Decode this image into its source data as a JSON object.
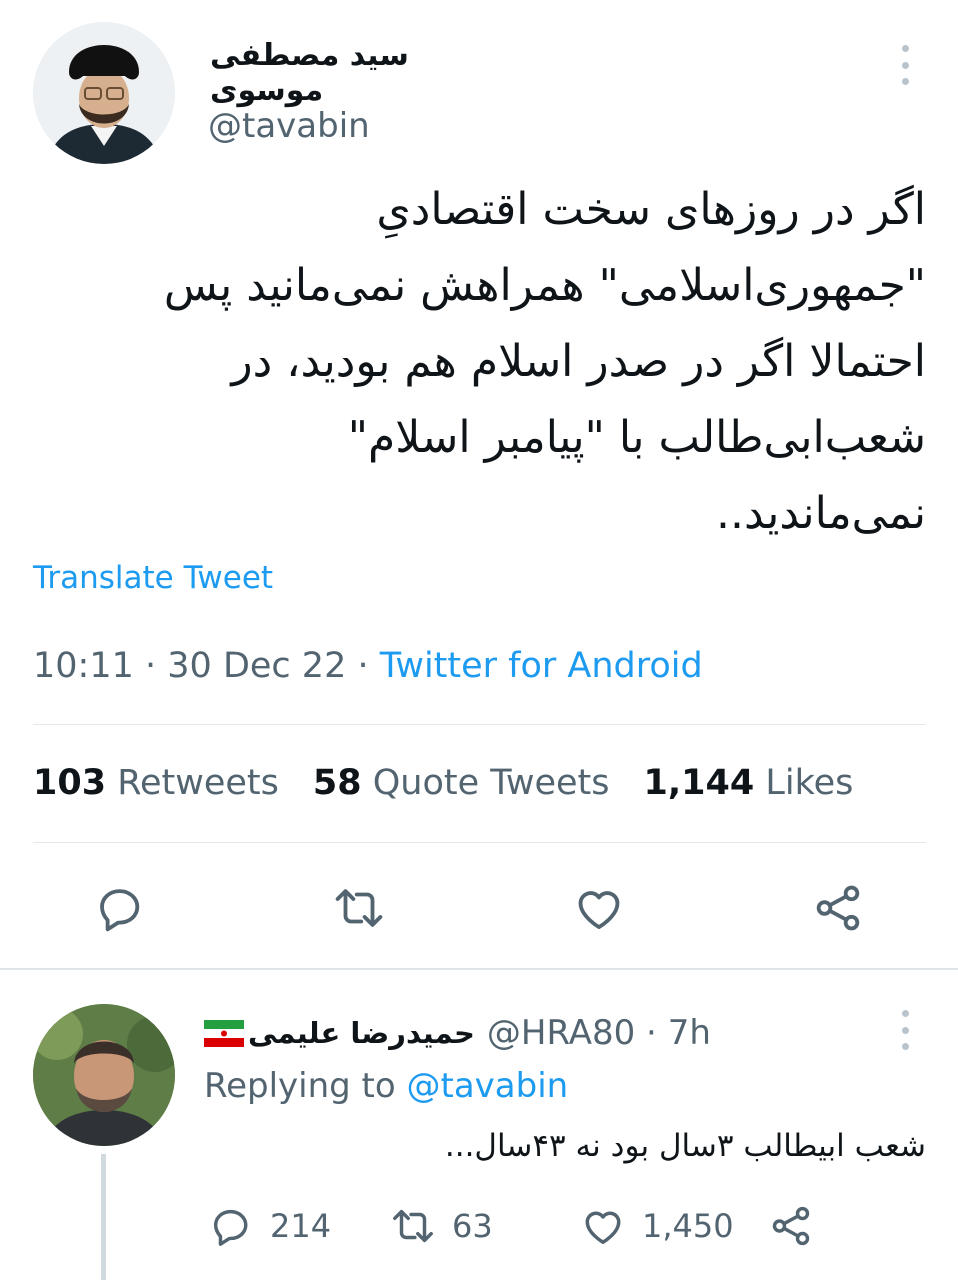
{
  "tweet": {
    "author_name": "سید مصطفی موسوی",
    "author_handle": "@tavabin",
    "body_lines": [
      "اگر در روزهای سخت اقتصادیِ",
      "\"جمهوری‌اسلامی\" همراهش نمی‌مانید پس",
      "احتمالا اگر در صدر اسلام هم بودید، در",
      "شعب‌ابی‌طالب با \"پیامبر اسلام\"",
      "نمی‌ماندید.."
    ],
    "translate_label": "Translate Tweet",
    "time": "10:11",
    "date": "30 Dec 22",
    "source": "Twitter for Android",
    "stats": {
      "retweets_count": "103",
      "retweets_label": "Retweets",
      "quotes_count": "58",
      "quotes_label": "Quote Tweets",
      "likes_count": "1,144",
      "likes_label": "Likes"
    }
  },
  "reply": {
    "author_name": "حمیدرضا علیمی",
    "author_handle": "@HRA80",
    "age": "7h",
    "replying_prefix": "Replying to",
    "replying_to": "@tavabin",
    "body": "شعب ابیطالب ۳سال بود نه ۴۳سال...",
    "counts": {
      "replies": "214",
      "retweets": "63",
      "likes": "1,450"
    }
  },
  "colors": {
    "link": "#1d9bf0",
    "secondary_text": "#536471",
    "icon": "#536471"
  }
}
